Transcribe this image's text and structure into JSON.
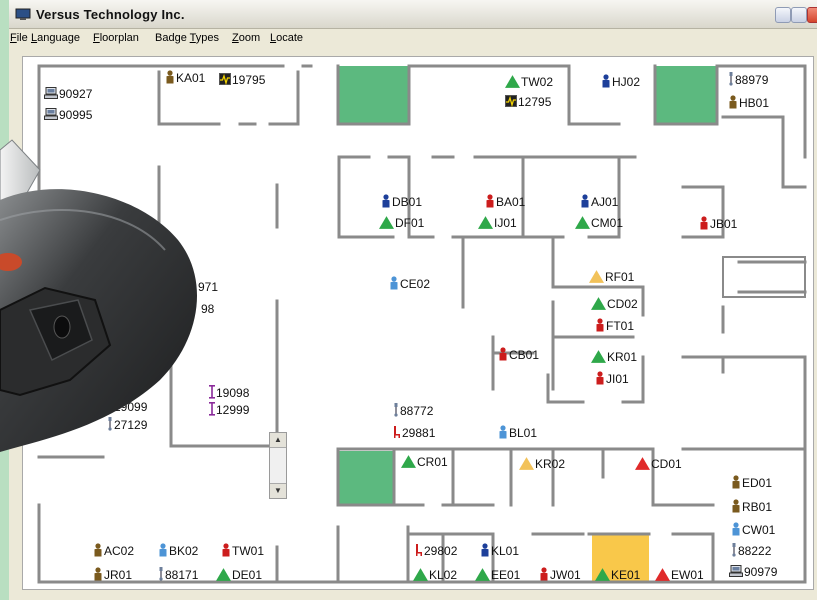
{
  "window": {
    "title": "Versus Technology Inc."
  },
  "menu": [
    {
      "label": "File",
      "u": "F"
    },
    {
      "label": "Language",
      "u": "L"
    },
    {
      "label": "Floorplan",
      "u": "F"
    },
    {
      "label": "Badge Types",
      "u": "T"
    },
    {
      "label": "Zoom",
      "u": "Z"
    },
    {
      "label": "Locate",
      "u": "L"
    }
  ],
  "colors": {
    "room_green": "#5cb97f",
    "room_yellow": "#f9c84a",
    "wall": "#8a8a8a",
    "alert_green": "#2fa84a",
    "alert_yellow": "#f2c25a",
    "alert_red": "#e02a2a"
  },
  "badges": [
    {
      "id": "90927",
      "icon": "computer-icon"
    },
    {
      "id": "90995",
      "icon": "computer-icon"
    },
    {
      "id": "KA01",
      "icon": "person-brown-icon"
    },
    {
      "id": "19795",
      "icon": "monitor-heartbeat-icon"
    },
    {
      "id": "TW02",
      "icon": "triangle-green-icon"
    },
    {
      "id": "12795",
      "icon": "monitor-heartbeat-icon"
    },
    {
      "id": "HJ02",
      "icon": "person-blue-icon"
    },
    {
      "id": "88979",
      "icon": "iv-pump-icon"
    },
    {
      "id": "HB01",
      "icon": "person-brown-icon"
    },
    {
      "id": "DB01",
      "icon": "person-blue-icon"
    },
    {
      "id": "DF01",
      "icon": "triangle-green-icon"
    },
    {
      "id": "BA01",
      "icon": "person-red-icon"
    },
    {
      "id": "IJ01",
      "icon": "triangle-green-icon"
    },
    {
      "id": "AJ01",
      "icon": "person-blue-icon"
    },
    {
      "id": "CM01",
      "icon": "triangle-green-icon"
    },
    {
      "id": "JB01",
      "icon": "person-red-icon"
    },
    {
      "id": "CE02",
      "icon": "person-lightblue-icon"
    },
    {
      "id": "RF01",
      "icon": "triangle-yellow-icon"
    },
    {
      "id": "CD02",
      "icon": "triangle-green-icon"
    },
    {
      "id": "FT01",
      "icon": "person-red-icon"
    },
    {
      "id": "CB01",
      "icon": "person-red-icon"
    },
    {
      "id": "KR01",
      "icon": "triangle-green-icon"
    },
    {
      "id": "JI01",
      "icon": "person-red-icon"
    },
    {
      "id": "971",
      "icon": ""
    },
    {
      "id": "98",
      "icon": ""
    },
    {
      "id": "19098",
      "icon": "pole-icon"
    },
    {
      "id": "12999",
      "icon": "pole-icon"
    },
    {
      "id": "29099",
      "icon": "iv-pump-icon"
    },
    {
      "id": "27129",
      "icon": "iv-pump-icon"
    },
    {
      "id": "88772",
      "icon": "iv-pump-icon"
    },
    {
      "id": "29881",
      "icon": "chair-icon"
    },
    {
      "id": "BL01",
      "icon": "person-lightblue-icon"
    },
    {
      "id": "CR01",
      "icon": "triangle-green-icon"
    },
    {
      "id": "KR02",
      "icon": "triangle-yellow-icon"
    },
    {
      "id": "CD01",
      "icon": "triangle-red-icon"
    },
    {
      "id": "ED01",
      "icon": "person-brown-icon"
    },
    {
      "id": "RB01",
      "icon": "person-brown-icon"
    },
    {
      "id": "CW01",
      "icon": "person-lightblue-icon"
    },
    {
      "id": "88222",
      "icon": "iv-pump-icon"
    },
    {
      "id": "90979",
      "icon": "computer-icon"
    },
    {
      "id": "AC02",
      "icon": "person-brown-icon"
    },
    {
      "id": "BK02",
      "icon": "person-lightblue-icon"
    },
    {
      "id": "TW01",
      "icon": "person-red-icon"
    },
    {
      "id": "JR01",
      "icon": "person-brown-icon"
    },
    {
      "id": "88171",
      "icon": "iv-pump-icon"
    },
    {
      "id": "DE01",
      "icon": "triangle-green-icon"
    },
    {
      "id": "29802",
      "icon": "chair-icon"
    },
    {
      "id": "KL01",
      "icon": "person-blue-icon"
    },
    {
      "id": "KL02",
      "icon": "triangle-green-icon"
    },
    {
      "id": "EE01",
      "icon": "triangle-green-icon"
    },
    {
      "id": "JW01",
      "icon": "person-red-icon"
    },
    {
      "id": "KE01",
      "icon": "triangle-green-icon"
    },
    {
      "id": "EW01",
      "icon": "triangle-red-icon"
    }
  ]
}
